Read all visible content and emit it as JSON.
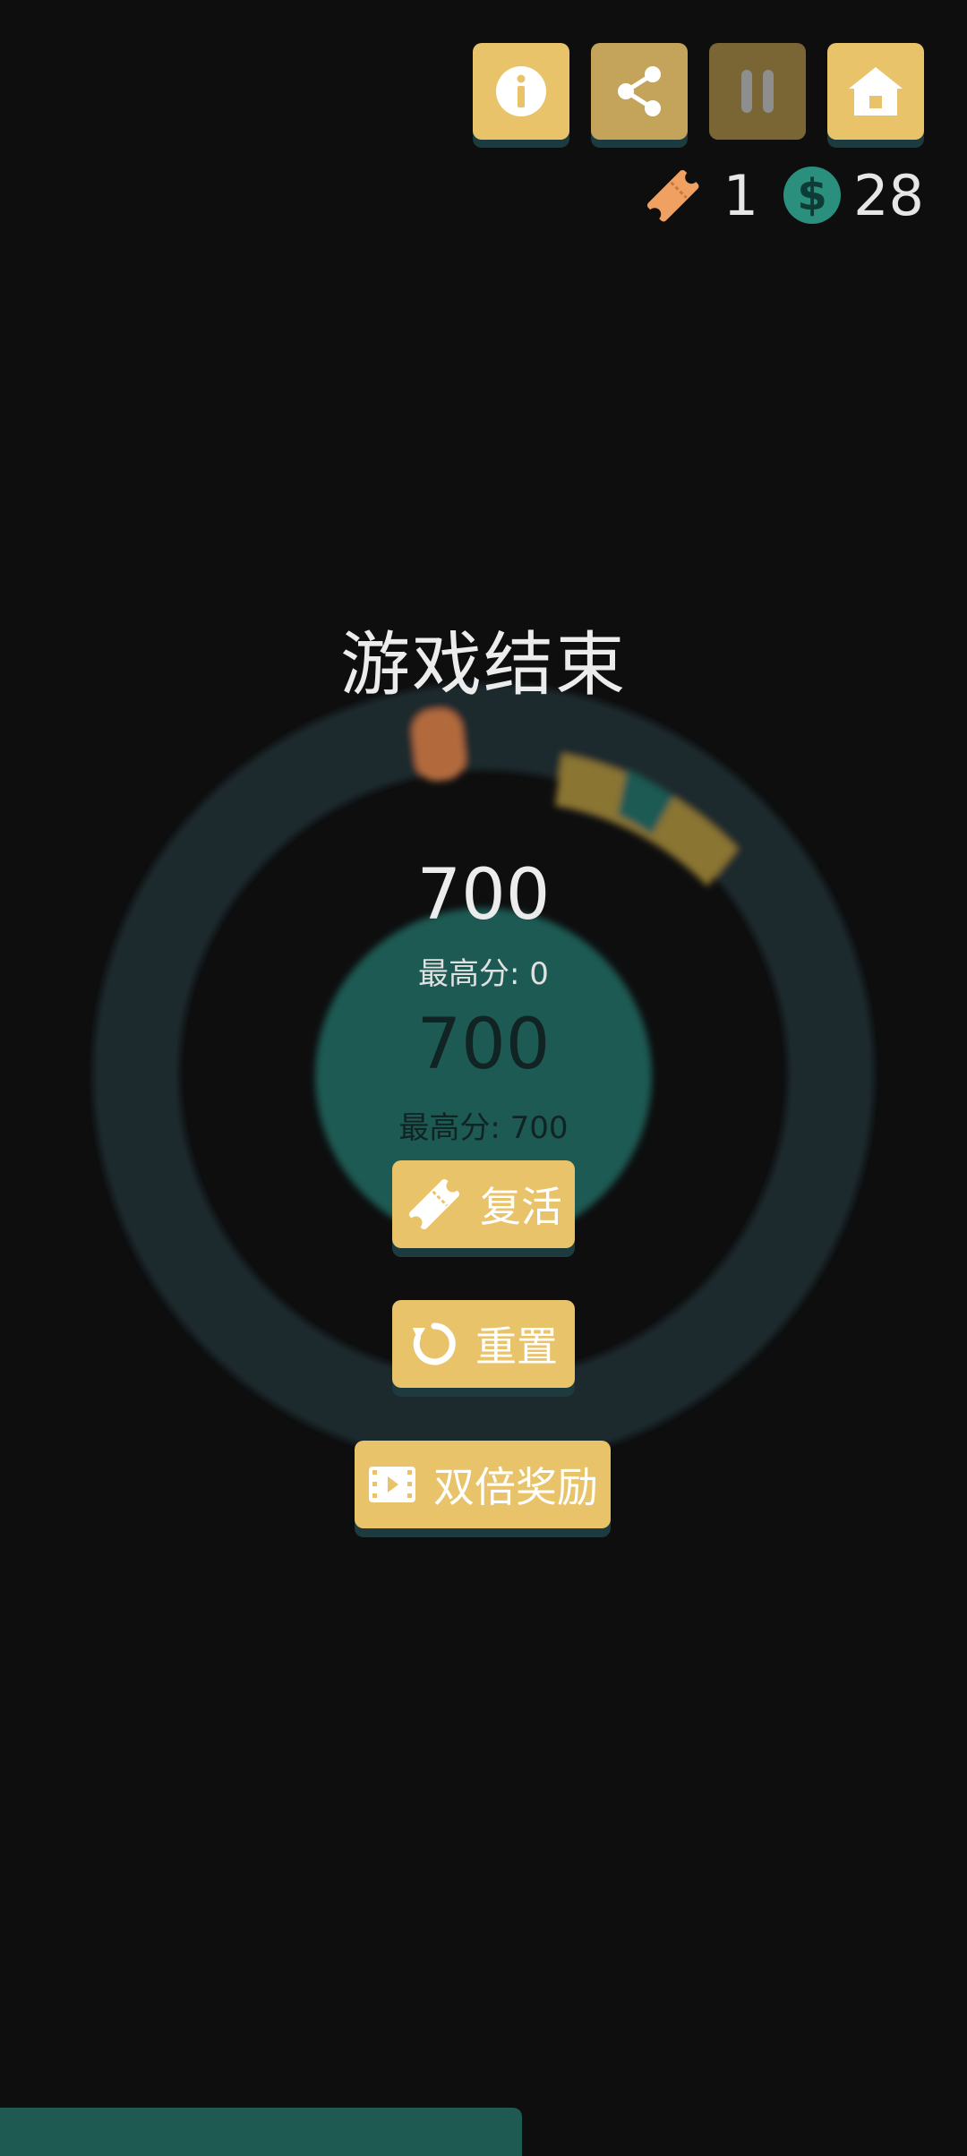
{
  "toolbar": {
    "info_icon": "info-icon",
    "share_icon": "share-icon",
    "pause_icon": "pause-icon",
    "home_icon": "home-icon"
  },
  "currency": {
    "tickets": "1",
    "coins": "28",
    "coin_symbol": "$"
  },
  "game_over": {
    "title": "游戏结束",
    "score": "700",
    "best_label": "最高分:  0",
    "background_score": "700",
    "background_best": "最高分:  700"
  },
  "buttons": {
    "revive": "复活",
    "reset": "重置",
    "double_reward": "双倍奖励"
  },
  "colors": {
    "accent": "#e8c36a",
    "teal": "#2b8f7e",
    "background": "#0e0e0f",
    "ticket": "#f0a060"
  }
}
